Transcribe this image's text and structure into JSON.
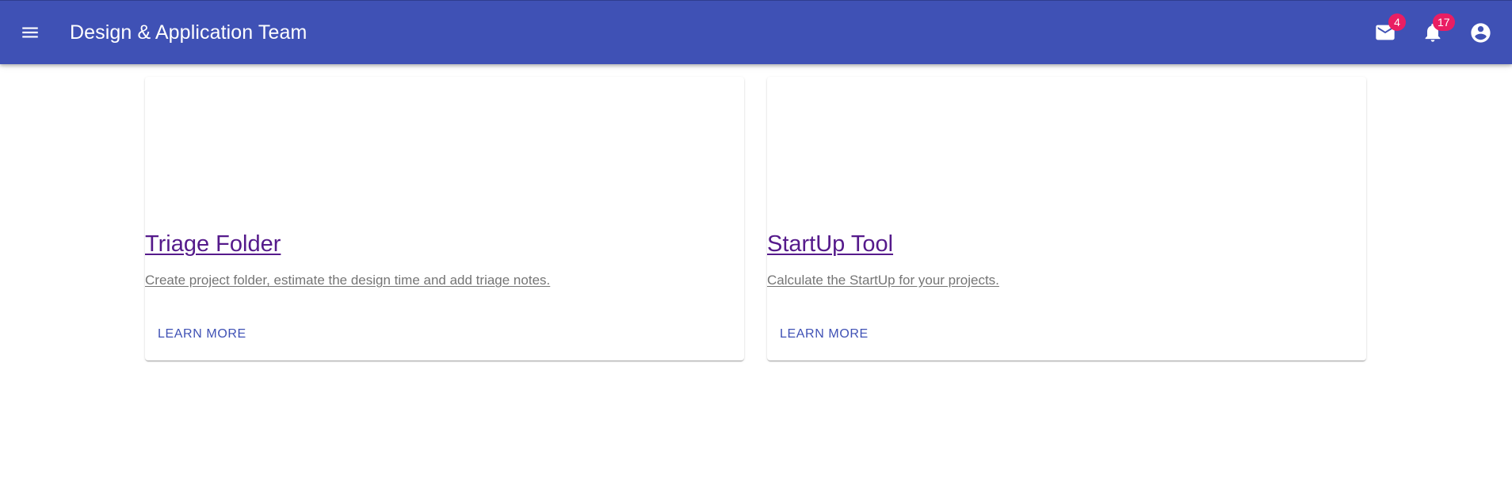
{
  "appbar": {
    "title": "Design & Application Team",
    "menu_icon": "menu-icon",
    "mail": {
      "icon": "mail-icon",
      "badge": "4"
    },
    "notifications": {
      "icon": "bell-icon",
      "badge": "17"
    },
    "account": {
      "icon": "account-circle-icon"
    },
    "color": "#3f51b5",
    "badge_color": "#e91e63"
  },
  "cards": [
    {
      "title": "Triage Folder",
      "description": "Create project folder, estimate the design time and add triage notes.",
      "action": "Learn More"
    },
    {
      "title": "StartUp Tool",
      "description": "Calculate the StartUp for your projects.",
      "action": "Learn More"
    }
  ]
}
